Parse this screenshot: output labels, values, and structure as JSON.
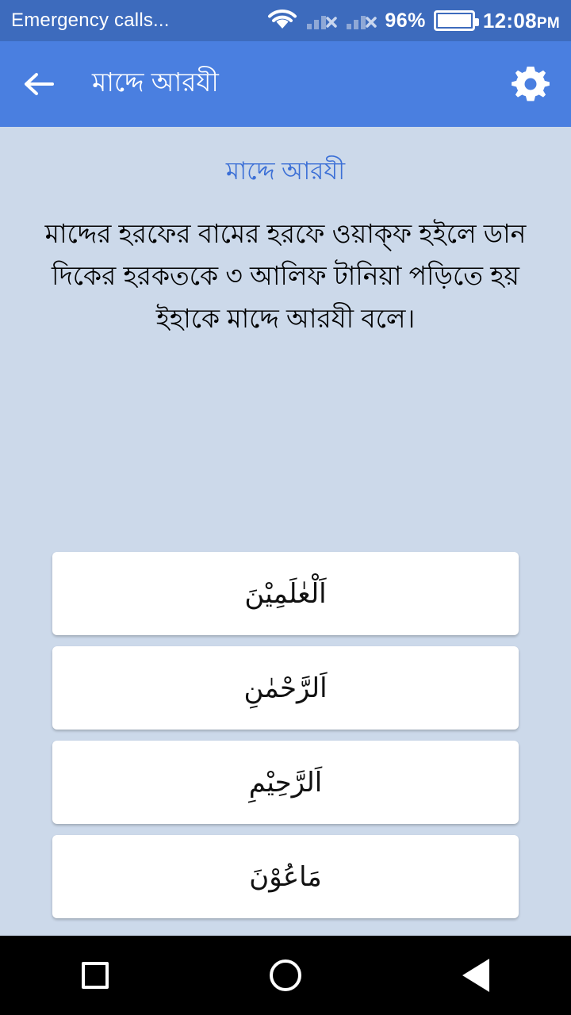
{
  "statusbar": {
    "carrier_text": "Emergency calls...",
    "wifi_icon": "wifi-icon",
    "signal1_icon": "signal-no-service-icon",
    "signal2_icon": "signal-no-service-icon",
    "battery_percent": "96%",
    "battery_icon": "battery-icon",
    "time": "12:08",
    "ampm": "PM",
    "bg_color": "#3d6bbd"
  },
  "appbar": {
    "back_icon": "back-arrow-icon",
    "title": "মাদ্দে আরযী",
    "settings_icon": "gear-icon",
    "bg_color": "#4a7fe0"
  },
  "content": {
    "heading": "মাদ্দে আরযী",
    "heading_color": "#3b6fd6",
    "body": "মাদ্দের হরফের বামের হরফে ওয়াক্‌ফ হইলে ডান দিকের হরকতকে  ৩  আলিফ টানিয়া পড়িতে হয়  ইহাকে মাদ্দে আরযী বলে।",
    "bg_color": "#ccd9ea",
    "options": [
      {
        "label": "اَلْعٰلَمِيْنَ"
      },
      {
        "label": "اَلرَّحْمٰنِ"
      },
      {
        "label": "اَلرَّحِيْمِ"
      },
      {
        "label": "مَاعُوْنَ"
      }
    ]
  },
  "navbar": {
    "recent_icon": "square-recents-icon",
    "home_icon": "circle-home-icon",
    "back_icon": "triangle-back-icon",
    "bg_color": "#000000"
  }
}
